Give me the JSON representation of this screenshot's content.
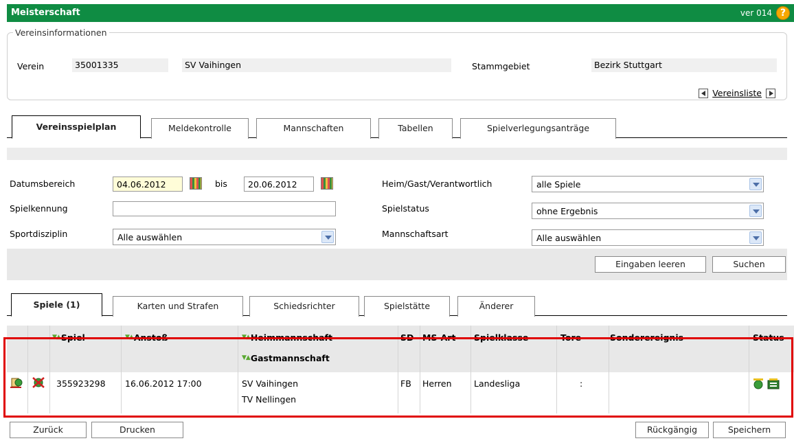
{
  "header": {
    "title": "Meisterschaft",
    "version": "ver 014",
    "help_icon": "help-icon"
  },
  "vereinsinfo": {
    "legend": "Vereinsinformationen",
    "verein_label": "Verein",
    "verein_nr": "35001335",
    "verein_name": "SV Vaihingen",
    "stammgebiet_label": "Stammgebiet",
    "stammgebiet": "Bezirk Stuttgart",
    "vereinsliste": "Vereinsliste"
  },
  "main_tabs": [
    {
      "label": "Vereinsspielplan",
      "active": true
    },
    {
      "label": "Meldekontrolle"
    },
    {
      "label": "Mannschaften"
    },
    {
      "label": "Tabellen"
    },
    {
      "label": "Spielverlegungsanträge"
    }
  ],
  "filter": {
    "datumsbereich_label": "Datumsbereich",
    "date_from": "04.06.2012",
    "bis_label": "bis",
    "date_to": "20.06.2012",
    "spielkennung_label": "Spielkennung",
    "spielkennung_value": "",
    "sportdisziplin_label": "Sportdisziplin",
    "sportdisziplin_value": "Alle auswählen",
    "heimgast_label": "Heim/Gast/Verantwortlich",
    "heimgast_value": "alle Spiele",
    "spielstatus_label": "Spielstatus",
    "spielstatus_value": "ohne Ergebnis",
    "mannschaftsart_label": "Mannschaftsart",
    "mannschaftsart_value": "Alle auswählen",
    "clear_button": "Eingaben leeren",
    "search_button": "Suchen"
  },
  "sub_tabs": [
    {
      "label": "Spiele (1)",
      "active": true
    },
    {
      "label": "Karten und Strafen"
    },
    {
      "label": "Schiedsrichter"
    },
    {
      "label": "Spielstätte"
    },
    {
      "label": "Änderer"
    }
  ],
  "table": {
    "columns": {
      "spiel": "Spiel",
      "anstoss": "Anstoß",
      "heim": "Heimmannschaft",
      "gast": "Gastmannschaft",
      "sd": "SD",
      "msart": "MS-Art",
      "spielklasse": "Spielklasse",
      "tore": "Tore",
      "sonder": "Sonderereignis",
      "status": "Status"
    },
    "rows": [
      {
        "spiel": "355923298",
        "anstoss": "16.06.2012 17:00",
        "heim": "SV Vaihingen",
        "gast": "TV Nellingen",
        "sd": "FB",
        "msart": "Herren",
        "spielklasse": "Landesliga",
        "tore": ":",
        "sonder": ""
      }
    ]
  },
  "footer": {
    "back": "Zurück",
    "print": "Drucken",
    "undo": "Rückgängig",
    "save": "Speichern"
  },
  "colors": {
    "header_green": "#0f8c43",
    "highlight_red": "#e00000",
    "date_yellow": "#fffdd8"
  }
}
